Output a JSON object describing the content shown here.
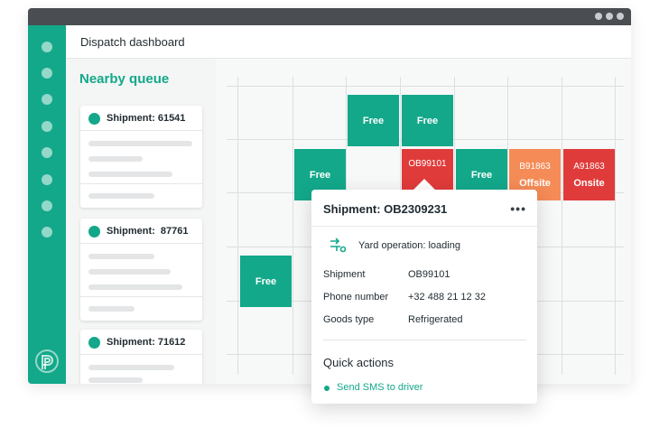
{
  "app": {
    "title": "Dispatch dashboard"
  },
  "colors": {
    "accent": "#13a88a",
    "danger": "#e03b3b",
    "warning": "#f58b57"
  },
  "queue": {
    "title": "Nearby queue",
    "cards": [
      {
        "label": "Shipment: 61541"
      },
      {
        "label": "Shipment:  87761"
      },
      {
        "label": "Shipment: 71612"
      }
    ]
  },
  "grid": {
    "cells": [
      {
        "label": "Free",
        "sub": "",
        "status": "free"
      },
      {
        "label": "Free",
        "sub": "",
        "status": "free"
      },
      {
        "label": "Free",
        "sub": "",
        "status": "free"
      },
      {
        "label": "OB99101",
        "sub": "",
        "status": "red"
      },
      {
        "label": "Free",
        "sub": "",
        "status": "free"
      },
      {
        "label": "B91863",
        "sub": "Offsite",
        "status": "orange"
      },
      {
        "label": "A91863",
        "sub": "Onsite",
        "status": "red"
      },
      {
        "label": "Free",
        "sub": "",
        "status": "free"
      }
    ]
  },
  "popup": {
    "title": "Shipment: OB2309231",
    "more_icon": "more-horizontal-icon",
    "operation": "Yard operation: loading",
    "rows": [
      {
        "label": "Shipment",
        "value": "OB99101"
      },
      {
        "label": "Phone number",
        "value": "+32 488 21 12 32"
      },
      {
        "label": "Goods type",
        "value": "Refrigerated"
      }
    ],
    "quick_actions_title": "Quick actions",
    "quick_action": "Send SMS to driver"
  }
}
